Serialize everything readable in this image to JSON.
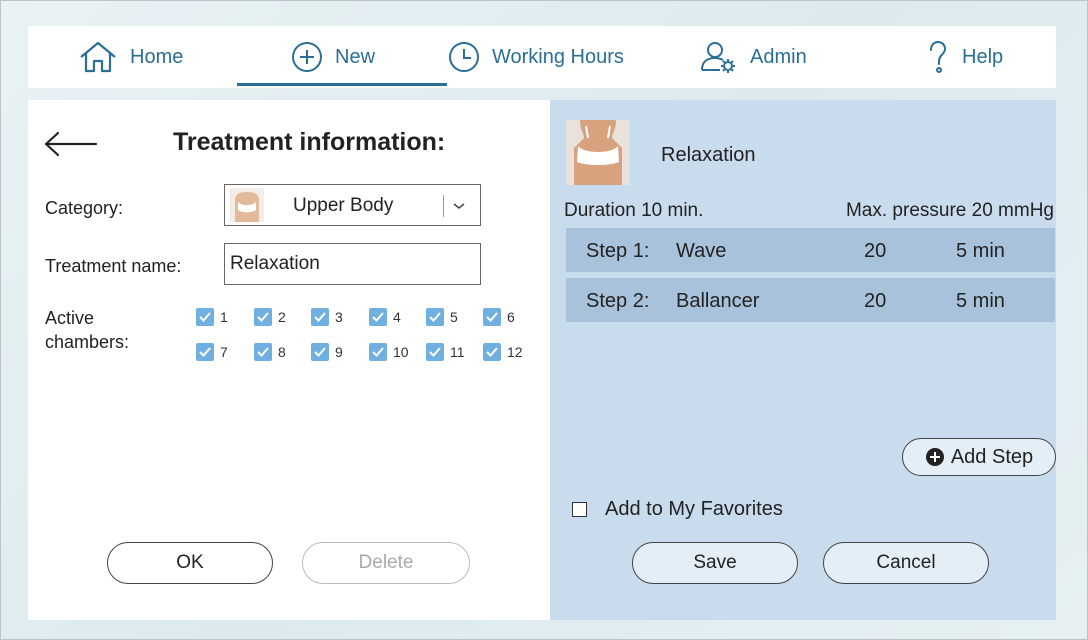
{
  "nav": {
    "home": "Home",
    "new": "New",
    "working_hours": "Working Hours",
    "admin": "Admin",
    "help": "Help",
    "active_tab": "New"
  },
  "form": {
    "title": "Treatment information:",
    "category_label": "Category:",
    "category_value": "Upper Body",
    "name_label": "Treatment name:",
    "name_value": "Relaxation",
    "chambers_label_line1": "Active",
    "chambers_label_line2": "chambers:",
    "chambers": [
      {
        "label": "1",
        "checked": true
      },
      {
        "label": "2",
        "checked": true
      },
      {
        "label": "3",
        "checked": true
      },
      {
        "label": "4",
        "checked": true
      },
      {
        "label": "5",
        "checked": true
      },
      {
        "label": "6",
        "checked": true
      },
      {
        "label": "7",
        "checked": true
      },
      {
        "label": "8",
        "checked": true
      },
      {
        "label": "9",
        "checked": true
      },
      {
        "label": "10",
        "checked": true
      },
      {
        "label": "11",
        "checked": true
      },
      {
        "label": "12",
        "checked": true
      }
    ],
    "ok_label": "OK",
    "delete_label": "Delete"
  },
  "summary": {
    "title": "Relaxation",
    "duration": "Duration 10 min.",
    "max_pressure": "Max. pressure 20 mmHg",
    "steps": [
      {
        "step": "Step 1:",
        "name": "Wave",
        "pressure": "20",
        "time": "5 min"
      },
      {
        "step": "Step 2:",
        "name": "Ballancer",
        "pressure": "20",
        "time": "5 min"
      }
    ],
    "add_step_label": "Add Step",
    "favorites_label": "Add to My Favorites",
    "favorites_checked": false,
    "save_label": "Save",
    "cancel_label": "Cancel"
  },
  "colors": {
    "accent": "#2b6e96",
    "checkbox": "#6fb0e0",
    "right_panel": "#c9dced",
    "step_row": "#a9c2dc"
  }
}
